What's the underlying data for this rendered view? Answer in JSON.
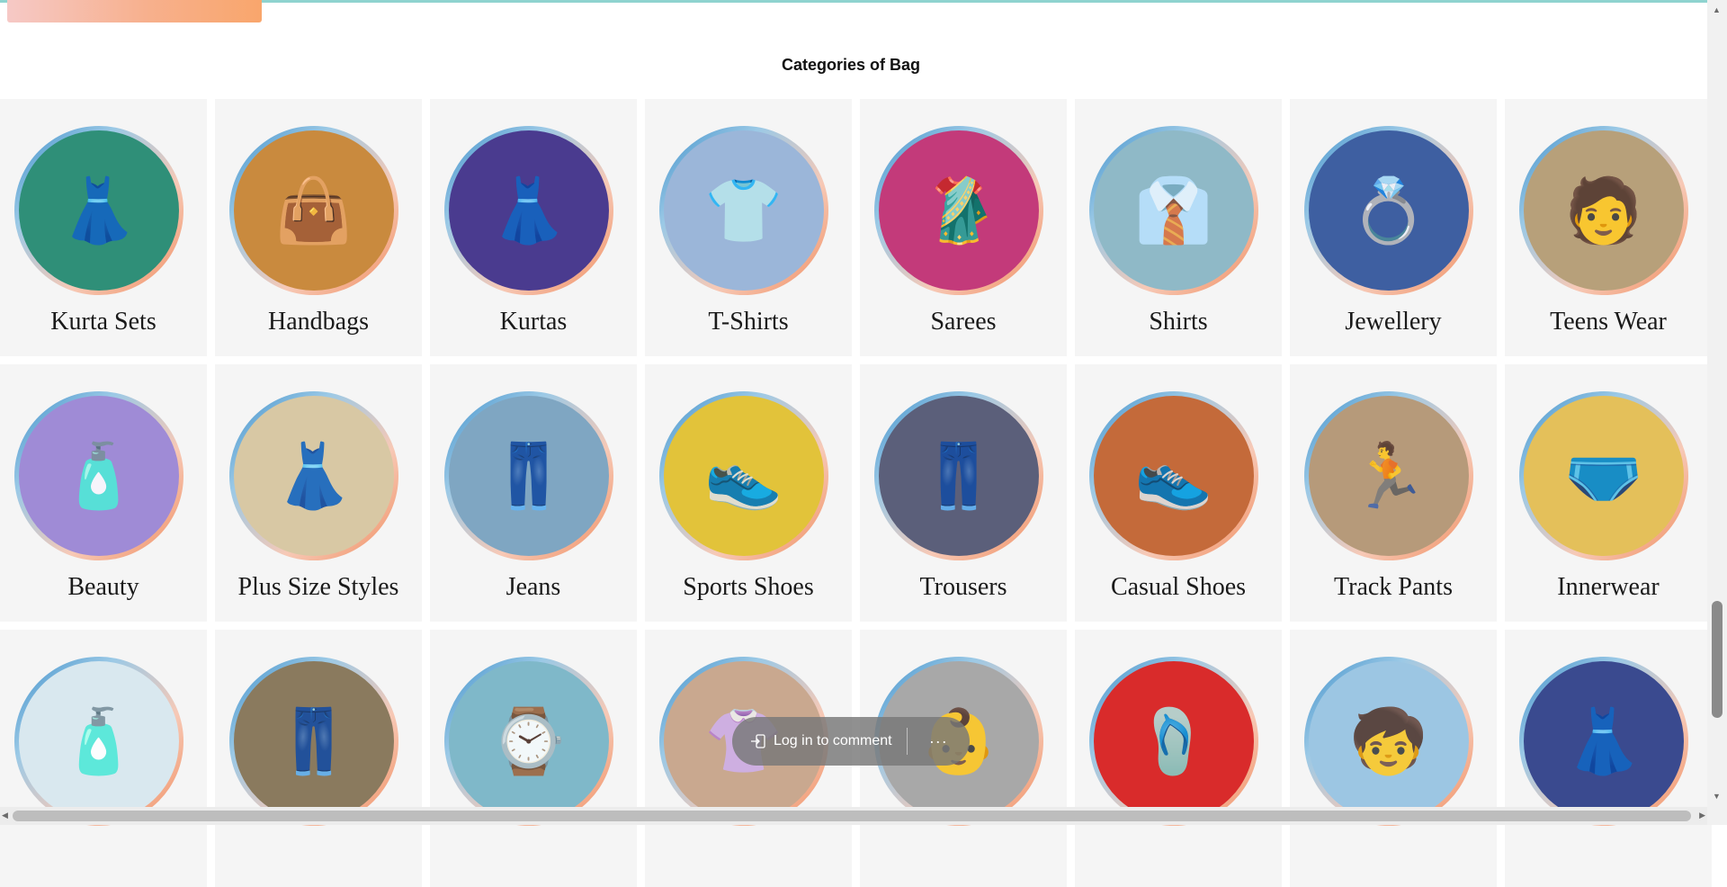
{
  "page": {
    "section_title": "Categories of Bag"
  },
  "categories": [
    {
      "label": "Kurta Sets",
      "icon": "dress-icon",
      "glyph": "👗",
      "bg": "#2f8f78"
    },
    {
      "label": "Handbags",
      "icon": "handbag-icon",
      "glyph": "👜",
      "bg": "#c98a3e"
    },
    {
      "label": "Kurtas",
      "icon": "dress-icon",
      "glyph": "👗",
      "bg": "#4a3b8f"
    },
    {
      "label": "T-Shirts",
      "icon": "tshirt-icon",
      "glyph": "👕",
      "bg": "#9bb6d9"
    },
    {
      "label": "Sarees",
      "icon": "saree-icon",
      "glyph": "🥻",
      "bg": "#c33a7a"
    },
    {
      "label": "Shirts",
      "icon": "shirt-icon",
      "glyph": "👔",
      "bg": "#8fb9c7"
    },
    {
      "label": "Jewellery",
      "icon": "earring-icon",
      "glyph": "💍",
      "bg": "#3e5fa1"
    },
    {
      "label": "Teens Wear",
      "icon": "teens-icon",
      "glyph": "🧑",
      "bg": "#b7a07a"
    },
    {
      "label": "Beauty",
      "icon": "cosmetics-icon",
      "glyph": "🧴",
      "bg": "#9f8bd6"
    },
    {
      "label": "Plus Size Styles",
      "icon": "dress-icon",
      "glyph": "👗",
      "bg": "#d8c8a4"
    },
    {
      "label": "Jeans",
      "icon": "jeans-icon",
      "glyph": "👖",
      "bg": "#7fa6c2"
    },
    {
      "label": "Sports Shoes",
      "icon": "sneaker-icon",
      "glyph": "👟",
      "bg": "#e2c33a"
    },
    {
      "label": "Trousers",
      "icon": "trousers-icon",
      "glyph": "👖",
      "bg": "#5b5f7a"
    },
    {
      "label": "Casual Shoes",
      "icon": "shoe-icon",
      "glyph": "👟",
      "bg": "#c46a3a"
    },
    {
      "label": "Track Pants",
      "icon": "trackpants-icon",
      "glyph": "🏃",
      "bg": "#b69a7a"
    },
    {
      "label": "Innerwear",
      "icon": "innerwear-icon",
      "glyph": "🩲",
      "bg": "#e4c05a"
    },
    {
      "label": "",
      "icon": "skincare-icon",
      "glyph": "🧴",
      "bg": "#d9e8ef"
    },
    {
      "label": "",
      "icon": "trousers-icon",
      "glyph": "👖",
      "bg": "#8a7a5e"
    },
    {
      "label": "",
      "icon": "watch-icon",
      "glyph": "⌚",
      "bg": "#7fb8c9"
    },
    {
      "label": "",
      "icon": "dress-icon",
      "glyph": "👚",
      "bg": "#c9a88f"
    },
    {
      "label": "",
      "icon": "baby-icon",
      "glyph": "👶",
      "bg": "#a8a8a8"
    },
    {
      "label": "",
      "icon": "slipper-icon",
      "glyph": "🩴",
      "bg": "#d92b2b"
    },
    {
      "label": "",
      "icon": "kids-icon",
      "glyph": "🧒",
      "bg": "#9cc6e3"
    },
    {
      "label": "",
      "icon": "dress-icon",
      "glyph": "👗",
      "bg": "#3a4a8f"
    }
  ],
  "comment_bar": {
    "login_label": "Log in to comment",
    "more_label": "···"
  }
}
